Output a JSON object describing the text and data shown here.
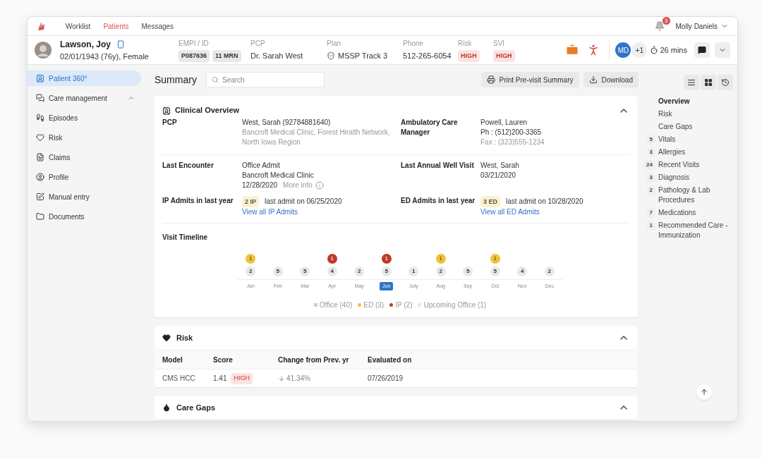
{
  "top_nav": {
    "tabs": [
      {
        "label": "Worklist",
        "selected": false
      },
      {
        "label": "Patients",
        "selected": true
      },
      {
        "label": "Messages",
        "selected": false
      }
    ],
    "notification_count": "3",
    "user": "Molly Daniels"
  },
  "patient": {
    "name": "Lawson, Joy",
    "dob": "02/01/1943 (76y), Female",
    "fields": [
      {
        "label": "EMPI / ID",
        "values": [
          {
            "text": "P087636",
            "kind": "chip"
          },
          {
            "text": "11 MRN",
            "kind": "chip"
          }
        ]
      },
      {
        "label": "PCP",
        "values": [
          {
            "text": "Dr. Sarah West",
            "kind": "plain"
          }
        ]
      },
      {
        "label": "Plan",
        "values": [
          {
            "text": "MSSP Track 3",
            "kind": "plan"
          }
        ]
      },
      {
        "label": "Phone",
        "values": [
          {
            "text": "512-265-6054",
            "kind": "plain"
          }
        ]
      },
      {
        "label": "Risk",
        "values": [
          {
            "text": "HIGH",
            "kind": "risk"
          }
        ]
      },
      {
        "label": "SVI",
        "values": [
          {
            "text": "HIGH",
            "kind": "risk"
          }
        ]
      }
    ],
    "care_team": {
      "initials": "MD",
      "more": "+1"
    },
    "timer": "26 mins"
  },
  "sidebar": {
    "items": [
      {
        "label": "Patient 360°",
        "selected": true,
        "kind": "link"
      },
      {
        "label": "Care management",
        "selected": false,
        "kind": "group"
      },
      {
        "label": "Episodes",
        "selected": false,
        "kind": "link"
      },
      {
        "label": "Risk",
        "selected": false,
        "kind": "link"
      },
      {
        "label": "Claims",
        "selected": false,
        "kind": "link"
      },
      {
        "label": "Profile",
        "selected": false,
        "kind": "link"
      },
      {
        "label": "Manual entry",
        "selected": false,
        "kind": "link"
      },
      {
        "label": "Documents",
        "selected": false,
        "kind": "link"
      }
    ]
  },
  "toolbar": {
    "title": "Summary",
    "search_placeholder": "Search",
    "buttons": [
      "Print Pre-visit Summary",
      "Download"
    ]
  },
  "clinical_overview": {
    "title": "Clinical Overview",
    "expanded": true,
    "sections": [
      [
        {
          "label": "PCP",
          "lines": [
            [
              {
                "text": "West, Sarah (92784881640)",
                "kind": "plain"
              }
            ],
            [
              {
                "text": "Bancroft Medical Clinic, Forest Health Network, North Iowa Region",
                "kind": "muted"
              }
            ]
          ]
        },
        {
          "label": "Ambulatory Care Manager",
          "lines": [
            [
              {
                "text": "Powell, Lauren",
                "kind": "plain"
              }
            ],
            [
              {
                "text": "Ph : (512)200-3365",
                "kind": "plain"
              }
            ],
            [
              {
                "text": "Fax : (323)555-1234",
                "kind": "muted"
              }
            ]
          ]
        }
      ],
      [
        {
          "label": "Last Encounter",
          "lines": [
            [
              {
                "text": "Office Admit",
                "kind": "plain"
              }
            ],
            [
              {
                "text": "Bancroft Medical Clinic",
                "kind": "plain"
              }
            ],
            [
              {
                "text": "12/28/2020",
                "kind": "plain"
              },
              {
                "text": "More info",
                "kind": "info"
              }
            ]
          ]
        },
        {
          "label": "Last Annual Well Visit",
          "lines": [
            [
              {
                "text": "West, Sarah",
                "kind": "plain"
              }
            ],
            [
              {
                "text": "03/21/2020",
                "kind": "plain"
              }
            ]
          ]
        },
        {
          "label": "IP Admits in last year",
          "lines": [
            [
              {
                "text": "2 IP",
                "kind": "badge"
              },
              {
                "text": "last admit on 06/25/2020",
                "kind": "plain"
              }
            ],
            [
              {
                "text": "View all IP Admits",
                "kind": "link"
              }
            ]
          ]
        },
        {
          "label": "ED Admits in last year",
          "lines": [
            [
              {
                "text": "3 ED",
                "kind": "badge"
              },
              {
                "text": "last admit on 10/28/2020",
                "kind": "plain"
              }
            ],
            [
              {
                "text": "View all ED Admits",
                "kind": "link"
              }
            ]
          ]
        }
      ]
    ],
    "timeline": {
      "title": "Visit Timeline",
      "months": [
        {
          "label": "Jan",
          "office": "2",
          "selected": false,
          "event": {
            "kind": "ed",
            "count": "1"
          }
        },
        {
          "label": "Feb",
          "office": "5",
          "selected": false
        },
        {
          "label": "Mar",
          "office": "5",
          "selected": false
        },
        {
          "label": "Apr",
          "office": "4",
          "selected": false,
          "event": {
            "kind": "ip",
            "count": "1"
          }
        },
        {
          "label": "May",
          "office": "2",
          "selected": false
        },
        {
          "label": "Jun",
          "office": "5",
          "selected": true,
          "event": {
            "kind": "ip",
            "count": "1"
          }
        },
        {
          "label": "July",
          "office": "1",
          "selected": false
        },
        {
          "label": "Aug",
          "office": "2",
          "selected": false,
          "event": {
            "kind": "ed",
            "count": "1"
          }
        },
        {
          "label": "Sep",
          "office": "5",
          "selected": false
        },
        {
          "label": "Oct",
          "office": "5",
          "selected": false,
          "event": {
            "kind": "ed",
            "count": "1"
          }
        },
        {
          "label": "Nov",
          "office": "4",
          "selected": false
        },
        {
          "label": "Dec",
          "office": "2",
          "selected": false
        }
      ],
      "legend": [
        {
          "label": "Office (40)",
          "kind": "office",
          "color": "#cccccc"
        },
        {
          "label": "ED (3)",
          "kind": "ed",
          "color": "#f2c037"
        },
        {
          "label": "IP (2)",
          "kind": "ip",
          "color": "#c0392b"
        },
        {
          "label": "Upcoming Office (1)",
          "kind": "upcoming",
          "color": "#e6e6e6"
        }
      ]
    }
  },
  "risk": {
    "title": "Risk",
    "expanded": true,
    "columns": [
      "Model",
      "Score",
      "Change from Prev. yr",
      "Evaluated on"
    ],
    "rows": [
      {
        "model": "CMS HCC",
        "score": "1.41",
        "level": "HIGH",
        "change": "41.34%",
        "evaluated": "07/26/2019"
      }
    ]
  },
  "care_gaps": {
    "title": "Care Gaps",
    "expanded": true
  },
  "right_nav": {
    "items": [
      {
        "label": "Overview",
        "selected": true
      },
      {
        "label": "Risk",
        "selected": false
      },
      {
        "label": "Care Gaps",
        "selected": false
      },
      {
        "count": "5",
        "label": "Vitals",
        "selected": false
      },
      {
        "count": "3",
        "label": "Allergies",
        "selected": false
      },
      {
        "count": "24",
        "label": "Recent Visits",
        "selected": false
      },
      {
        "count": "3",
        "label": "Diagnosis",
        "selected": false
      },
      {
        "count": "2",
        "label": "Pathology & Lab Procedures",
        "selected": false
      },
      {
        "count": "7",
        "label": "Medications",
        "selected": false
      },
      {
        "count": "1",
        "label": "Recommended Care - Immunization",
        "selected": false
      }
    ]
  }
}
